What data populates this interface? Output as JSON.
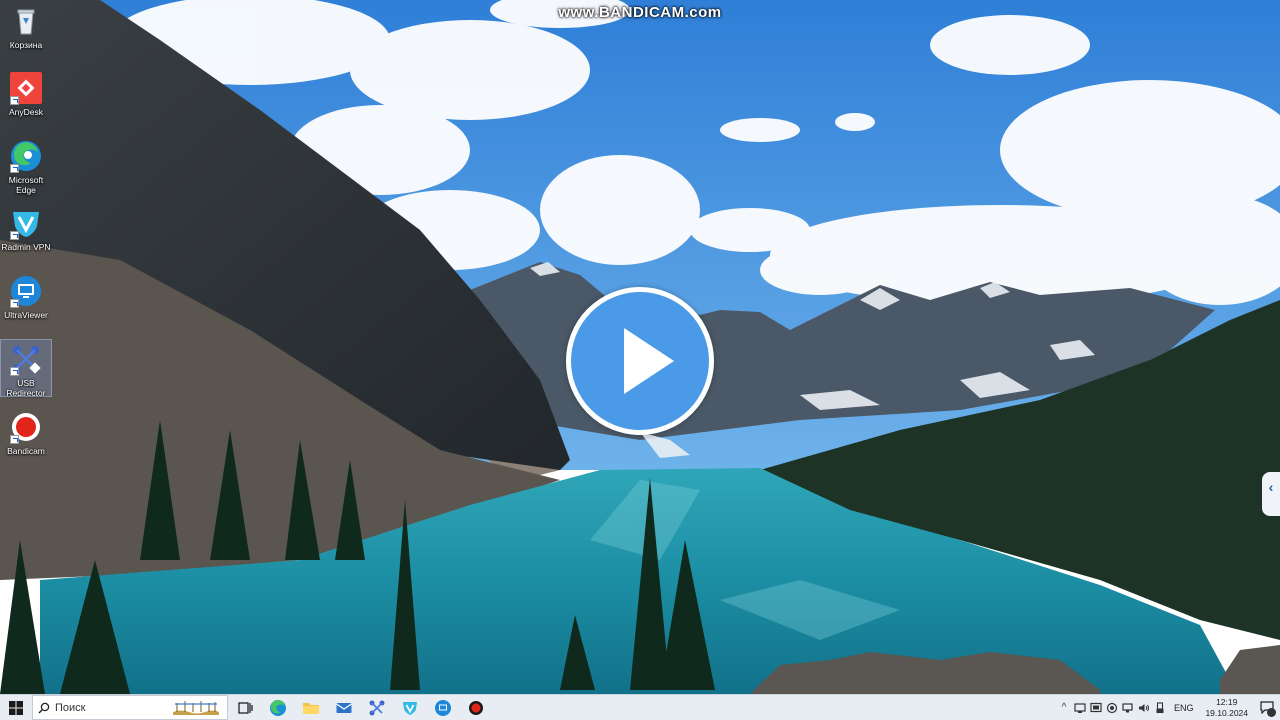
{
  "watermark": "www.BANDICAM.com",
  "desktop": {
    "icons": [
      {
        "label": "Корзина",
        "icon": "recycle-bin-icon"
      },
      {
        "label": "AnyDesk",
        "icon": "anydesk-icon"
      },
      {
        "label": "Microsoft Edge",
        "icon": "edge-icon"
      },
      {
        "label": "Radmin VPN",
        "icon": "radmin-vpn-icon"
      },
      {
        "label": "UltraViewer",
        "icon": "ultraviewer-icon"
      },
      {
        "label": "USB Redirector",
        "icon": "usb-redirector-icon"
      },
      {
        "label": "Bandicam",
        "icon": "bandicam-icon"
      }
    ]
  },
  "player": {
    "play_icon": "play-icon"
  },
  "taskbar": {
    "search_placeholder": "Поиск",
    "pinned": [
      "task-view-icon",
      "edge-icon",
      "file-explorer-icon",
      "mail-icon",
      "usb-redirector-icon",
      "radmin-vpn-icon",
      "ultraviewer-icon",
      "bandicam-icon"
    ],
    "tray": {
      "chevron": "^",
      "language": "ENG",
      "time": "12:19",
      "date": "19.10.2024"
    }
  },
  "colors": {
    "play_button": "#4a9ae8",
    "taskbar": "#e8edf3",
    "anydesk": "#ef443b",
    "bandicam": "#e1251b"
  }
}
